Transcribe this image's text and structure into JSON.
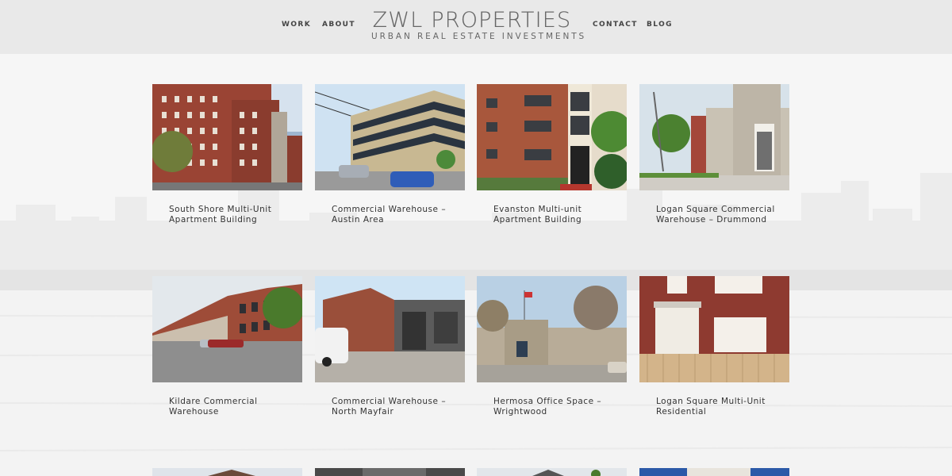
{
  "header": {
    "nav_left": [
      {
        "label": "WORK"
      },
      {
        "label": "ABOUT"
      }
    ],
    "logo": {
      "title": "ZWL PROPERTIES",
      "subtitle": "URBAN REAL ESTATE INVESTMENTS"
    },
    "nav_right": [
      {
        "label": "CONTACT"
      },
      {
        "label": "BLOG"
      }
    ]
  },
  "portfolio": {
    "items": [
      {
        "title": "South Shore Multi-Unit Apartment Building",
        "image": "red-brick-apartment-photo"
      },
      {
        "title": "Commercial Warehouse – Austin Area",
        "image": "commercial-warehouse-photo"
      },
      {
        "title": "Evanston Multi-unit Apartment Building",
        "image": "evanston-apartment-photo"
      },
      {
        "title": "Logan Square Commercial Warehouse – Drummond",
        "image": "logan-square-warehouse-photo"
      },
      {
        "title": "Kildare Commercial Warehouse",
        "image": "kildare-warehouse-photo"
      },
      {
        "title": "Commercial Warehouse – North Mayfair",
        "image": "north-mayfair-warehouse-photo"
      },
      {
        "title": "Hermosa Office Space – Wrightwood",
        "image": "hermosa-office-photo"
      },
      {
        "title": "Logan Square Multi-Unit Residential",
        "image": "logan-square-residential-photo"
      }
    ]
  },
  "colors": {
    "header_bg": "#e9e9e9",
    "page_bg": "#f5f5f5",
    "text": "#333333",
    "logo": "#666666"
  }
}
